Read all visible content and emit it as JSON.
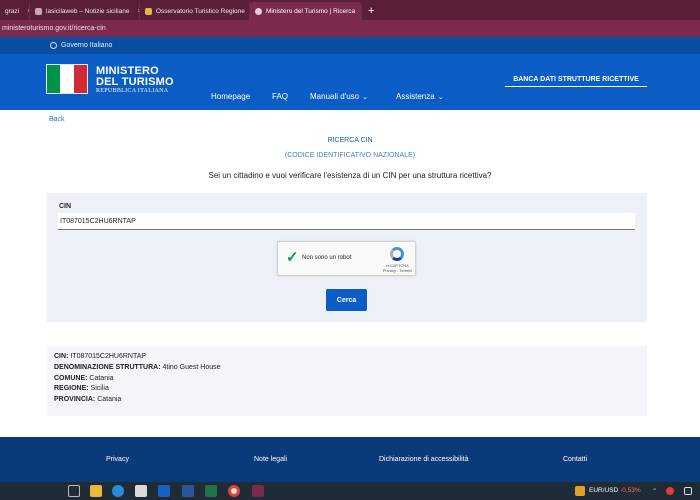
{
  "browser": {
    "tabs": [
      {
        "label": "grazi",
        "active": false
      },
      {
        "label": "lasicilaweb – Notizie siciliane",
        "active": false
      },
      {
        "label": "Osservatorio Turistico Regione",
        "active": false
      },
      {
        "label": "Ministero del Turismo | Ricerca",
        "active": true
      }
    ],
    "close_glyph": "×",
    "new_tab": "+",
    "url": "ministeroturismo.gov.it/ricerca-cin"
  },
  "header": {
    "gov_label": "Governo Italiano",
    "brand_line1": "MINISTERO",
    "brand_line2": "DEL TURISMO",
    "brand_line3": "REPUBBLICA ITALIANA",
    "banca_dati": "BANCA DATI STRUTTURE RICETTIVE",
    "flag_colors": [
      "#009246",
      "#ffffff",
      "#ce2b37"
    ],
    "nav": [
      {
        "label": "Homepage",
        "dropdown": false
      },
      {
        "label": "FAQ",
        "dropdown": false
      },
      {
        "label": "Manuali d'uso",
        "dropdown": true
      },
      {
        "label": "Assistenza",
        "dropdown": true
      }
    ]
  },
  "content": {
    "back": "Back",
    "title": "RICERCA CIN",
    "subtitle": "(CODICE IDENTIFICATIVO NAZIONALE)",
    "question": "Sei un cittadino e vuoi verificare l'esistenza di un CIN per una struttura ricettiva?",
    "form": {
      "cin_label": "CIN",
      "cin_value": "IT087015C2HU6RNTAP",
      "captcha_label": "Non sono un robot",
      "captcha_brand": "reCAPTCHA",
      "captcha_links": "Privacy - Termini",
      "submit_label": "Cerca"
    },
    "result": [
      {
        "label": "CIN:",
        "value": "IT087015C2HU6RNTAP"
      },
      {
        "label": "DENOMINAZIONE STRUTTURA:",
        "value": "4tino Guest House"
      },
      {
        "label": "COMUNE:",
        "value": "Catania"
      },
      {
        "label": "REGIONE:",
        "value": "Sicilia"
      },
      {
        "label": "PROVINCIA:",
        "value": "Catania"
      }
    ]
  },
  "footer": {
    "links": [
      "Privacy",
      "Note legali",
      "Dichiarazione di accessibilità",
      "Contatti"
    ]
  },
  "taskbar": {
    "icons": [
      "task-view-icon",
      "file-explorer-icon",
      "edge-icon",
      "photos-icon",
      "outlook-icon",
      "word-icon",
      "excel-icon",
      "chrome-icon",
      "snip-icon"
    ],
    "ticker": "EUR/USD",
    "change": "-0,53%",
    "accent_colors": {
      "primary": "#0b5cc4",
      "footer": "#0b3a7a",
      "browser": "#5b1f3a"
    }
  }
}
